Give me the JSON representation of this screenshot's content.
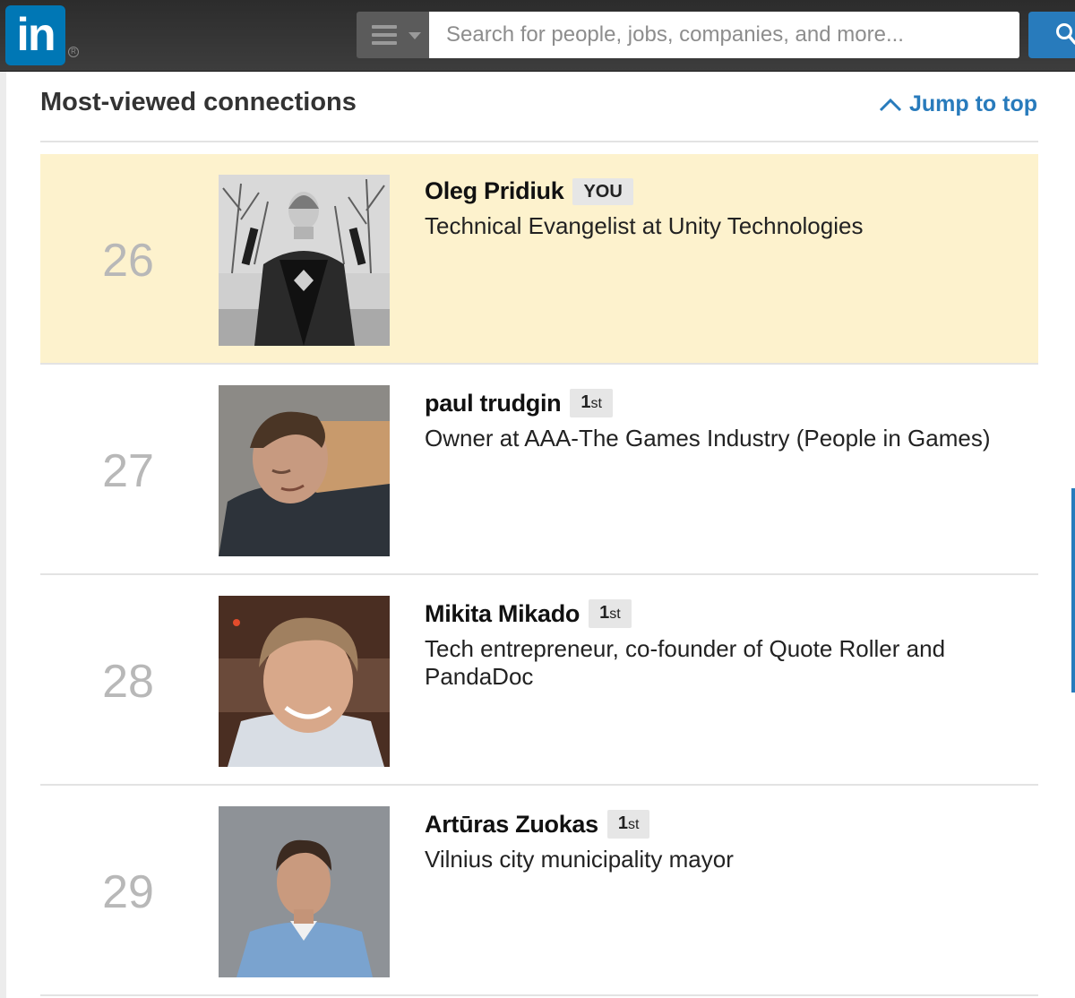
{
  "header": {
    "logo_text": "in",
    "search_placeholder": "Search for people, jobs, companies, and more...",
    "brand_color": "#0077b5"
  },
  "section": {
    "title": "Most-viewed connections",
    "jump_label": "Jump to top"
  },
  "connections": [
    {
      "rank": "26",
      "name": "Oleg Pridiuk",
      "badge": "YOU",
      "badge_num": "",
      "badge_ord": "",
      "headline": "Technical Evangelist at Unity Technologies",
      "highlight": true
    },
    {
      "rank": "27",
      "name": "paul trudgin",
      "badge": "",
      "badge_num": "1",
      "badge_ord": "st",
      "headline": "Owner at AAA-The Games Industry (People in Games)",
      "highlight": false
    },
    {
      "rank": "28",
      "name": "Mikita Mikado",
      "badge": "",
      "badge_num": "1",
      "badge_ord": "st",
      "headline": "Tech entrepreneur, co-founder of Quote Roller and PandaDoc",
      "highlight": false
    },
    {
      "rank": "29",
      "name": "Artūras Zuokas",
      "badge": "",
      "badge_num": "1",
      "badge_ord": "st",
      "headline": "Vilnius city municipality mayor",
      "highlight": false
    }
  ]
}
